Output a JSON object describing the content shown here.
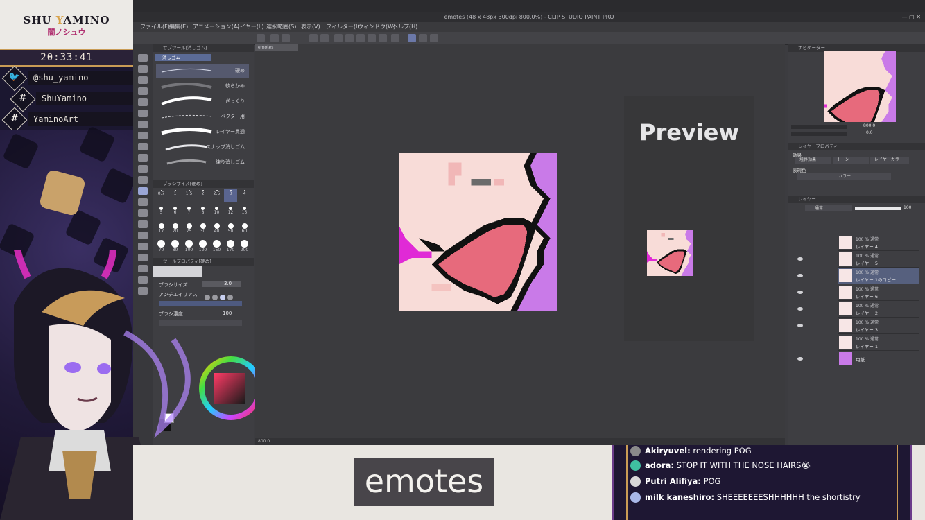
{
  "stream_overlay": {
    "brand_name_pre": "SHU ",
    "brand_name_y": "Y",
    "brand_name_post": "AMINO",
    "brand_jp": "闇ノシュウ",
    "clock": "20:33:41",
    "socials": [
      {
        "icon": "twitter-bird-icon",
        "text": "@shu_yamino"
      },
      {
        "icon": "hashtag-icon",
        "text": "ShuYamino"
      },
      {
        "icon": "hashtag-icon",
        "text": "YaminoArt"
      }
    ]
  },
  "caption": {
    "text": "emotes"
  },
  "chat": {
    "messages": [
      {
        "user": "Akiryuvel:",
        "text": "rendering POG",
        "avatar_color": "#8a8a8a"
      },
      {
        "user": "adora:",
        "text": "STOP IT WITH THE NOSE HAIRS😭",
        "avatar_color": "#3fbfa0"
      },
      {
        "user": "Putri Alifiya:",
        "text": "POG",
        "avatar_color": "#d8d8d8"
      },
      {
        "user": "milk kaneshiro:",
        "text": "SHEEEEEEESHHHHHH the shortistry",
        "avatar_color": "#a9b8e8"
      }
    ]
  },
  "app": {
    "window_title": "emotes (48 x 48px 300dpi 800.0%) - CLIP STUDIO PAINT PRO",
    "menu": [
      "ファイル(F)",
      "編集(E)",
      "アニメーション(A)",
      "レイヤー(L)",
      "選択範囲(S)",
      "表示(V)",
      "フィルター(I)",
      "ウィンドウ(W)",
      "ヘルプ(H)"
    ],
    "canvas_tab": "emotes",
    "subtool": {
      "header": "サブツール[消しゴム]",
      "group": "消しゴム",
      "strokes": [
        "硬め",
        "軟らかめ",
        "ざっくり",
        "ベクター用",
        "レイヤー貫通",
        "スナップ消しゴム",
        "練り消しゴム"
      ]
    },
    "brush_size_header": "ブラシサイズ[硬め]",
    "brush_sizes": [
      "0.7",
      "1",
      "1.5",
      "2",
      "2.5",
      "3",
      "4",
      "5",
      "6",
      "7",
      "8",
      "10",
      "12",
      "15",
      "17",
      "20",
      "25",
      "30",
      "40",
      "50",
      "60",
      "70",
      "80",
      "100",
      "120",
      "150",
      "170",
      "200"
    ],
    "tool_property": {
      "header": "ツールプロパティ[硬め]",
      "brush_size_label": "ブラシサイズ",
      "brush_size_value": "3.0",
      "antialias_label": "アンチエイリアス",
      "density_label": "ブラシ濃度",
      "density_value": "100"
    },
    "preview_label": "Preview",
    "navigator": {
      "header": "ナビゲーター",
      "zoom": "800.0",
      "angle": "0.0"
    },
    "layer_property": {
      "header": "レイヤープロパティ",
      "effect_label": "効果",
      "border_effect": "境界効果",
      "tone": "トーン",
      "layer_color": "レイヤーカラー",
      "expression_label": "表現色",
      "color_value": "カラー"
    },
    "layers_header": "レイヤー",
    "blend_mode": "通常",
    "opacity": "100",
    "layers": [
      {
        "opacity_mode": "100 % 通常",
        "name": "レイヤー 4",
        "visible": false
      },
      {
        "opacity_mode": "100 % 通常",
        "name": "レイヤー 5",
        "visible": true
      },
      {
        "opacity_mode": "100 % 通常",
        "name": "レイヤー 1のコピー",
        "visible": true,
        "selected": true
      },
      {
        "opacity_mode": "100 % 通常",
        "name": "レイヤー 6",
        "visible": true
      },
      {
        "opacity_mode": "100 % 通常",
        "name": "レイヤー 2",
        "visible": true
      },
      {
        "opacity_mode": "100 % 通常",
        "name": "レイヤー 3",
        "visible": true
      },
      {
        "opacity_mode": "100 % 通常",
        "name": "レイヤー 1",
        "visible": false
      },
      {
        "opacity_mode": "",
        "name": "用紙",
        "visible": true,
        "paper": true
      }
    ],
    "status_zoom": "800.0"
  }
}
